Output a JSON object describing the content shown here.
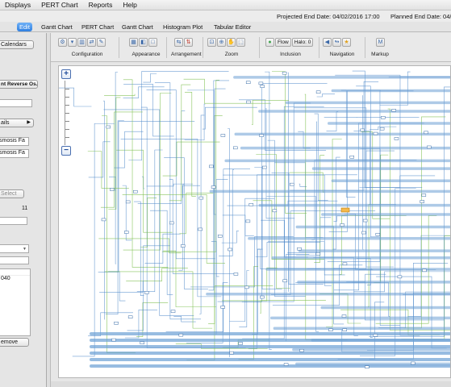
{
  "menubar": {
    "items": [
      "Displays",
      "PERT Chart",
      "Reports",
      "Help"
    ]
  },
  "info": {
    "projected_end": "Projected End Date: 04/02/2016 17:00",
    "planned_end": "Planned End Date: 04/"
  },
  "tabs": [
    {
      "label": "Edit",
      "active": true
    },
    {
      "label": "Gantt Chart",
      "active": false
    },
    {
      "label": "PERT Chart",
      "active": false
    },
    {
      "label": "Gantt Chart",
      "active": false
    },
    {
      "label": "Histogram Plot",
      "active": false
    },
    {
      "label": "Tabular Editor",
      "active": false
    }
  ],
  "left_panel": {
    "calendars_button": "Calendars",
    "project_button": "nt Reverse Os...",
    "details_button": "ails",
    "details_arrow": "▶",
    "field1_value": "smosis Fa",
    "field2_value": "smosis Fa",
    "select_button": "Select",
    "count_value": "11",
    "dropdown_arrow": "▼",
    "list_item": "040",
    "remove_button": "emove"
  },
  "toolbar": {
    "groups": [
      "Configuration",
      "Appearance",
      "Arrangement",
      "Zoom",
      "Inclusion",
      "Navigation",
      "Markup"
    ],
    "inclusion": {
      "flow_label": "Flow",
      "halo_label": "Halo: 0"
    }
  },
  "canvas": {
    "zoom_in": "+",
    "zoom_out": "−",
    "colors": {
      "dependency_blue": "#4a86c8",
      "critical_green": "#7cbf4e",
      "task_bar": "#6b9fd4",
      "highlight": "#f5b94a"
    }
  }
}
